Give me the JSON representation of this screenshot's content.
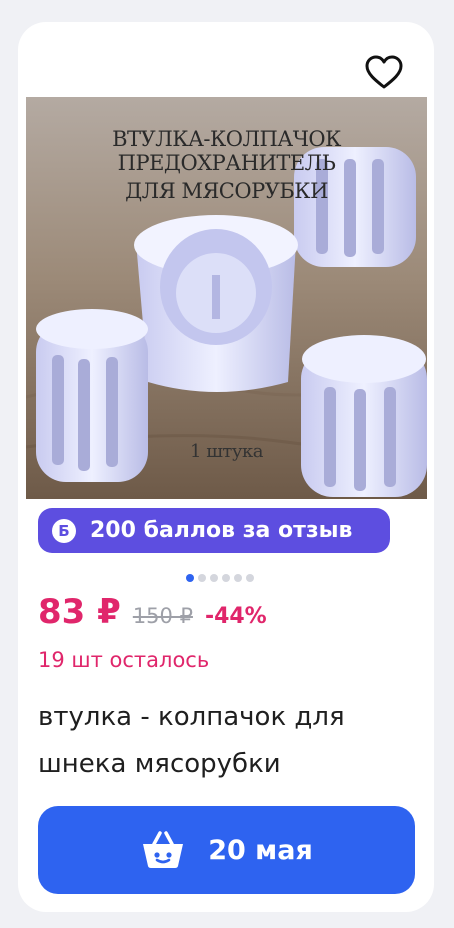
{
  "product": {
    "photo_caption_line1": "ВТУЛКА-КОЛПАЧОК ПРЕДОХРАНИТЕЛЬ",
    "photo_caption_line2": "ДЛЯ МЯСОРУБКИ",
    "photo_caption_qty": "1 штука",
    "bonus_icon_letter": "Б",
    "bonus_text": "200 баллов за отзыв",
    "gallery_count": 6,
    "gallery_active_index": 0,
    "price": "83 ₽",
    "old_price": "150 ₽",
    "discount": "-44%",
    "stock": "19 шт осталось",
    "title": "втулка - колпачок для шнека мясорубки"
  },
  "cart_button": {
    "label": "20 мая",
    "icon": "basket-icon"
  },
  "icons": {
    "favorite": "heart-outline-icon"
  },
  "colors": {
    "accent_blue": "#2e63f0",
    "bonus_purple": "#5d4ee0",
    "price_pink": "#e0266b",
    "old_price_gray": "#9ea0a8"
  }
}
